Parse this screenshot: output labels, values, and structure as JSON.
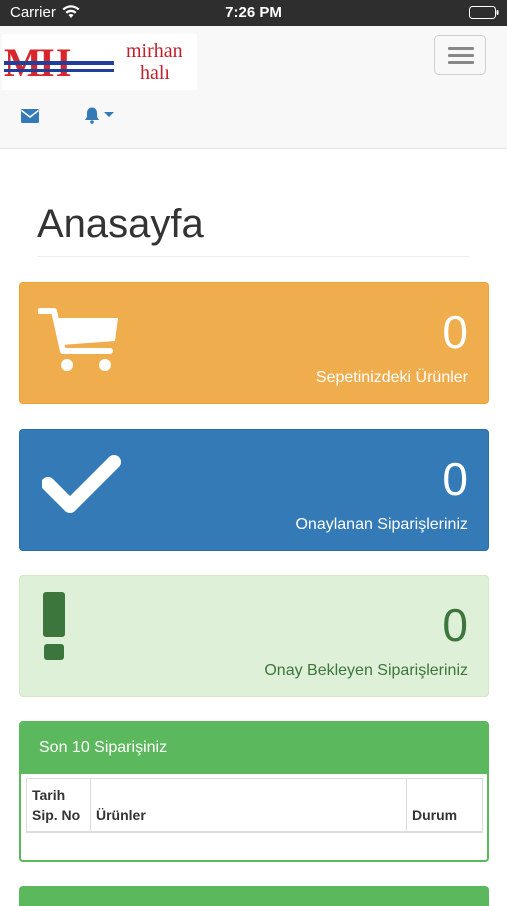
{
  "status_bar": {
    "carrier": "Carrier",
    "time": "7:26 PM"
  },
  "navbar": {
    "logo_mark": "MH",
    "brand_line1": "mirhan",
    "brand_line2": "halı"
  },
  "page": {
    "title": "Anasayfa"
  },
  "panels": [
    {
      "count": "0",
      "label": "Sepetinizdeki Ürünler",
      "icon": "cart-icon",
      "color": "#f0ad4e"
    },
    {
      "count": "0",
      "label": "Onaylanan Siparişleriniz",
      "icon": "check-icon",
      "color": "#337ab7"
    },
    {
      "count": "0",
      "label": "Onay Bekleyen Siparişleriniz",
      "icon": "exclamation-icon",
      "color": "#dff0d8"
    }
  ],
  "orders": {
    "title": "Son 10 Siparişiniz",
    "columns": {
      "date": "Tarih",
      "order_no": "Sip. No",
      "products": "Ürünler",
      "status": "Durum"
    }
  },
  "colors": {
    "accent_green": "#5cb85c",
    "brand_red": "#c21f2a",
    "brand_blue": "#1f3f9b"
  }
}
